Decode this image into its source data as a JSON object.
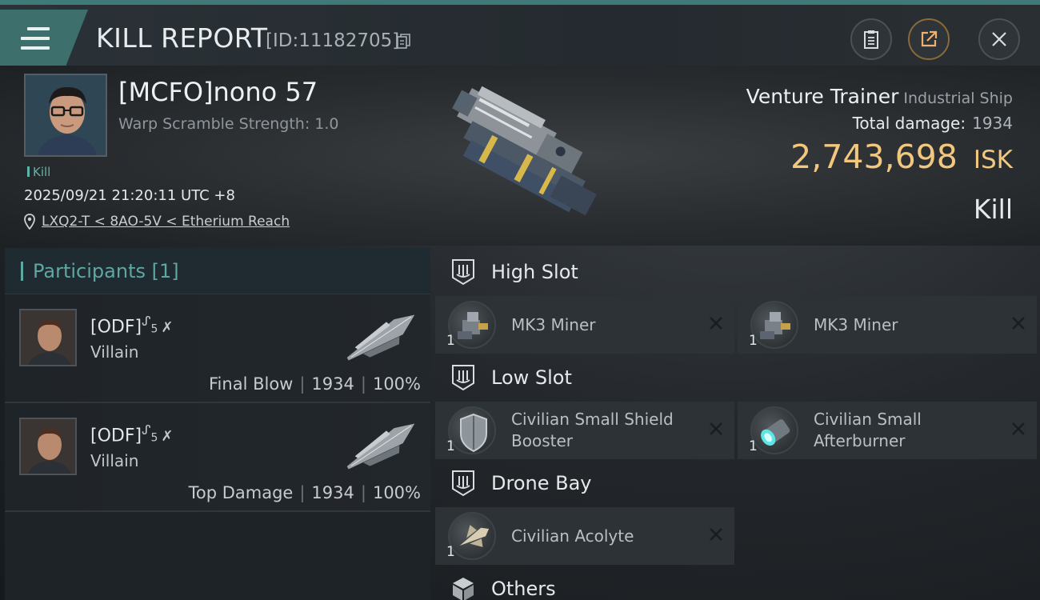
{
  "window": {
    "title": "KILL REPORT",
    "report_id": "[ID:11182705]"
  },
  "victim": {
    "name": "[MCFO]nono 57",
    "warp_scramble": "Warp Scramble Strength: 1.0",
    "tag": "Kill",
    "timestamp": "2025/09/21 21:20:11 UTC +8",
    "location": "LXQ2-T < 8AO-5V < Etherium Reach",
    "ship_name": "Venture Trainer",
    "ship_class": "Industrial Ship",
    "total_damage_label": "Total damage:",
    "total_damage": "1934",
    "isk_value": "2,743,698",
    "isk_label": "ISK",
    "result": "Kill"
  },
  "participants": {
    "header": "Participants [1]",
    "rows": [
      {
        "name": "[ODF]",
        "role": "Villain",
        "blow_label": "Final Blow",
        "damage": "1934",
        "percent": "100%"
      },
      {
        "name": "[ODF]",
        "role": "Villain",
        "blow_label": "Top Damage",
        "damage": "1934",
        "percent": "100%"
      }
    ]
  },
  "fittings": {
    "high_slot": {
      "label": "High Slot",
      "modules": [
        {
          "name": "MK3 Miner",
          "qty": "1",
          "icon": "miner-icon"
        },
        {
          "name": "MK3 Miner",
          "qty": "1",
          "icon": "miner-icon"
        }
      ]
    },
    "low_slot": {
      "label": "Low Slot",
      "modules": [
        {
          "name": "Civilian Small Shield Booster",
          "qty": "1",
          "icon": "shield-booster-icon"
        },
        {
          "name": "Civilian Small Afterburner",
          "qty": "1",
          "icon": "afterburner-icon"
        }
      ]
    },
    "drone_bay": {
      "label": "Drone Bay",
      "modules": [
        {
          "name": "Civilian Acolyte",
          "qty": "1",
          "icon": "drone-icon"
        }
      ]
    },
    "others": {
      "label": "Others"
    }
  },
  "colors": {
    "accent_teal": "#3d6f6d",
    "isk_gold": "#f1c87e",
    "participant_teal": "#5ea7a2"
  }
}
